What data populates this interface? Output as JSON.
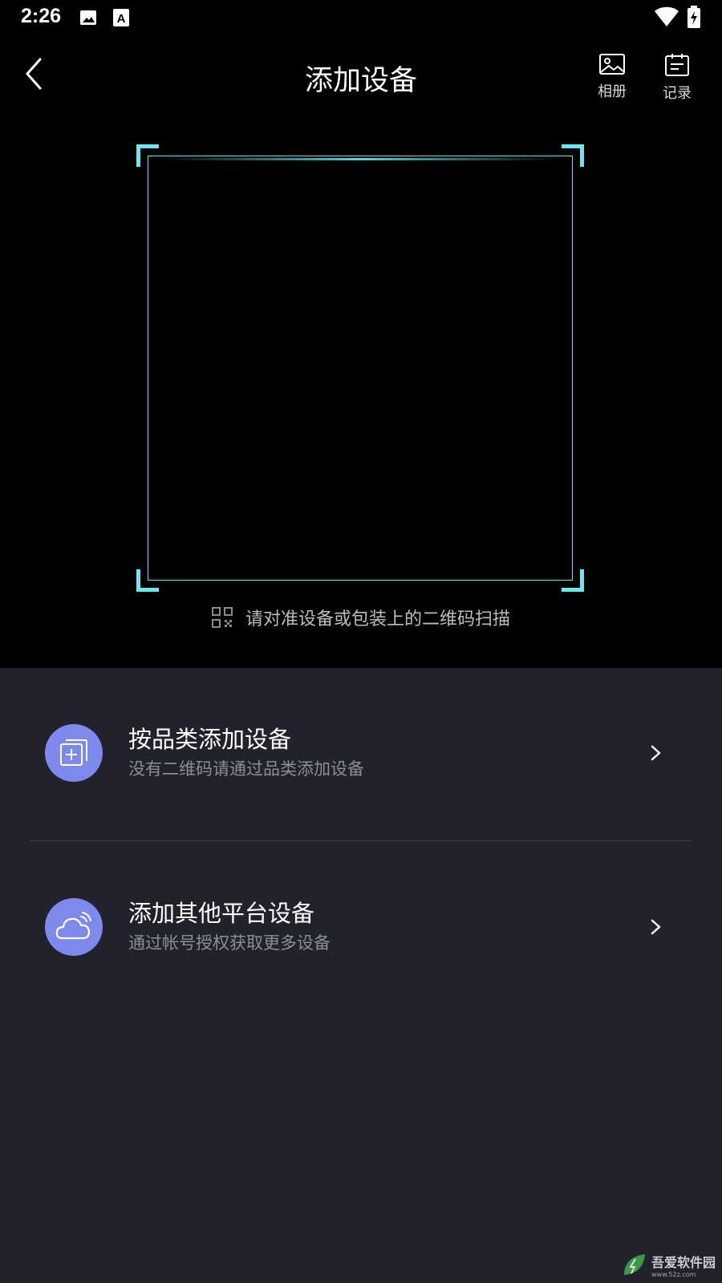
{
  "status_bar": {
    "time": "2:26",
    "icons": [
      "image-icon",
      "font-a-icon",
      "wifi-icon",
      "battery-charging-icon"
    ]
  },
  "header": {
    "back_icon": "back-chevron-icon",
    "title": "添加设备",
    "actions": [
      {
        "label": "相册",
        "icon": "gallery-icon"
      },
      {
        "label": "记录",
        "icon": "calendar-record-icon"
      }
    ]
  },
  "scanner": {
    "frame_color": "#6fe6ee",
    "hint_icon": "qr-code-icon",
    "hint_text": "请对准设备或包装上的二维码扫描"
  },
  "options": [
    {
      "title": "按品类添加设备",
      "subtitle": "没有二维码请通过品类添加设备",
      "icon": "add-category-icon",
      "icon_bg": "#7e89ee"
    },
    {
      "title": "添加其他平台设备",
      "subtitle": "通过帐号授权获取更多设备",
      "icon": "cloud-icon",
      "icon_bg": "#7e89ee"
    }
  ],
  "colors": {
    "background_top": "#000000",
    "panel_bg": "#21222b",
    "accent": "#7e89ee"
  },
  "watermark": {
    "text": "吾爱软件园",
    "url": "www.52z.com"
  }
}
